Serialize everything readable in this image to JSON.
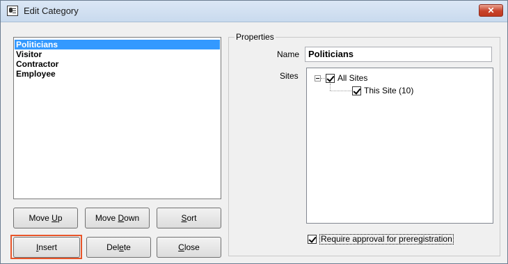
{
  "window": {
    "title": "Edit Category",
    "close_glyph": "✕"
  },
  "categories": {
    "items": [
      {
        "label": "Politicians",
        "selected": true
      },
      {
        "label": "Visitor",
        "selected": false
      },
      {
        "label": "Contractor",
        "selected": false
      },
      {
        "label": "Employee",
        "selected": false
      }
    ]
  },
  "buttons": {
    "move_up": {
      "pre": "Move ",
      "accel": "U",
      "post": "p"
    },
    "move_down": {
      "pre": "Move ",
      "accel": "D",
      "post": "own"
    },
    "sort": {
      "pre": "",
      "accel": "S",
      "post": "ort"
    },
    "insert": {
      "pre": "",
      "accel": "I",
      "post": "nsert"
    },
    "delete": {
      "pre": "Del",
      "accel": "e",
      "post": "te"
    },
    "close": {
      "pre": "",
      "accel": "C",
      "post": "lose"
    }
  },
  "properties": {
    "legend": "Properties",
    "name_label": "Name",
    "name_value": "Politicians",
    "sites_label": "Sites",
    "sites_tree": {
      "root": {
        "label": "All Sites",
        "checked": true
      },
      "child": {
        "label": "This Site (10)",
        "checked": true
      }
    },
    "require_approval": {
      "label": "Require approval for preregistration",
      "checked": true
    }
  },
  "colors": {
    "selection": "#3399ff",
    "highlight": "#e8552a",
    "close_button": "#c7432b"
  }
}
